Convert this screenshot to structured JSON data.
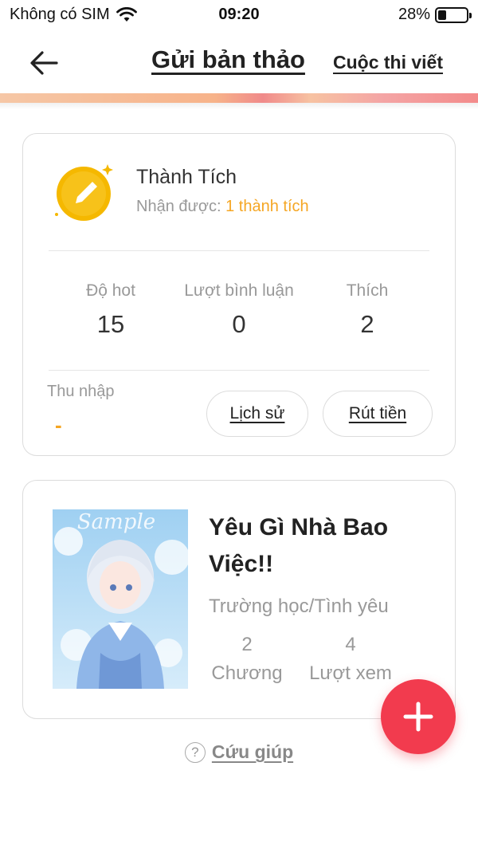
{
  "status_bar": {
    "carrier": "Không có SIM",
    "time": "09:20",
    "battery_percent": "28%",
    "battery_level": 0.28
  },
  "nav": {
    "back_icon": "arrow-left-icon",
    "title": "Gửi bản thảo",
    "contest_link": "Cuộc thi viết"
  },
  "achievement": {
    "icon": "pencil-badge-icon",
    "title": "Thành Tích",
    "received_label": "Nhận được:",
    "received_value": "1 thành tích",
    "stats": [
      {
        "label": "Độ hot",
        "value": "15"
      },
      {
        "label": "Lượt bình luận",
        "value": "0"
      },
      {
        "label": "Thích",
        "value": "2"
      }
    ],
    "income_label": "Thu nhập",
    "income_value": "-",
    "history_button": "Lịch sử",
    "withdraw_button": "Rút tiền"
  },
  "book": {
    "cover_watermark": "Sample",
    "title": "Yêu Gì Nhà Bao Việc!!",
    "genre": "Trường học/Tình yêu",
    "chapters_value": "2",
    "chapters_label": "Chương",
    "views_value": "4",
    "views_label": "Lượt xem"
  },
  "fab": {
    "icon": "plus-icon"
  },
  "help": {
    "icon": "question-circle-icon",
    "label": "Cứu giúp"
  },
  "colors": {
    "accent_orange": "#f5a623",
    "fab_red": "#f23b4e"
  }
}
